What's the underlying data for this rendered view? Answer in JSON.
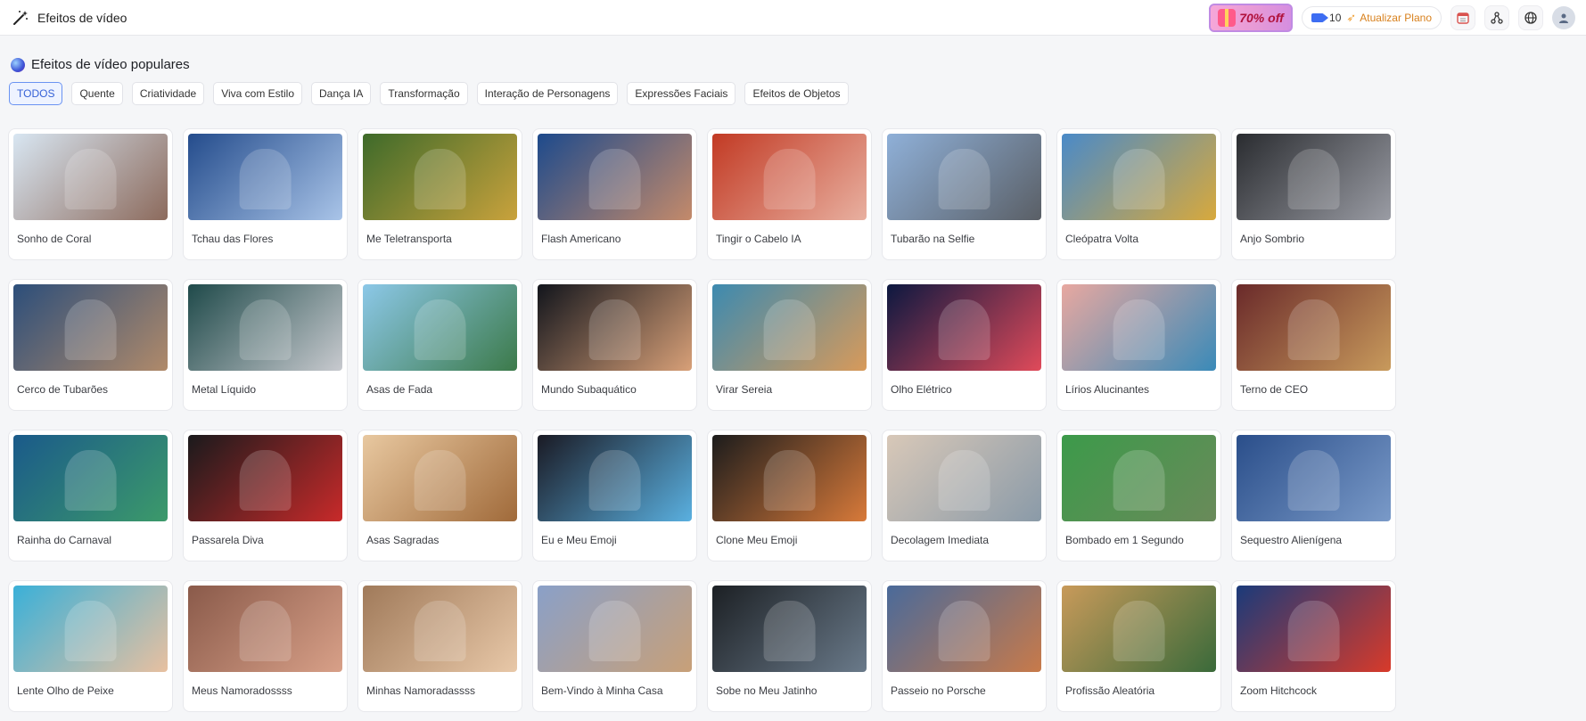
{
  "app": {
    "title": "Efeitos de vídeo",
    "title_icon": "magic-wand-icon"
  },
  "header": {
    "promo_label": "70% off",
    "credits": "10",
    "upgrade_label": "Atualizar Plano",
    "icons": [
      "calendar-icon",
      "share-network-icon",
      "globe-icon",
      "user-avatar-icon"
    ]
  },
  "section": {
    "title": "Efeitos de vídeo populares"
  },
  "filters": [
    {
      "label": "TODOS",
      "active": true
    },
    {
      "label": "Quente"
    },
    {
      "label": "Criatividade"
    },
    {
      "label": "Viva com Estilo"
    },
    {
      "label": "Dança IA"
    },
    {
      "label": "Transformação"
    },
    {
      "label": "Interação de Personagens"
    },
    {
      "label": "Expressões Faciais"
    },
    {
      "label": "Efeitos de Objetos"
    }
  ],
  "effects": [
    {
      "title": "Sonho de Coral",
      "colors": [
        "#d8e6f2",
        "#8c6a5c"
      ]
    },
    {
      "title": "Tchau das Flores",
      "colors": [
        "#244c8c",
        "#a9c4e8"
      ]
    },
    {
      "title": "Me Teletransporta",
      "colors": [
        "#3e6a2a",
        "#c9a23c"
      ]
    },
    {
      "title": "Flash Americano",
      "colors": [
        "#1d4a8c",
        "#c48a6a"
      ]
    },
    {
      "title": "Tingir o Cabelo IA",
      "colors": [
        "#c23a24",
        "#e8b0a0"
      ]
    },
    {
      "title": "Tubarão na Selfie",
      "colors": [
        "#8fb0d8",
        "#5a5f66"
      ]
    },
    {
      "title": "Cleópatra Volta",
      "colors": [
        "#4a8ac8",
        "#d8a93c"
      ]
    },
    {
      "title": "Anjo Sombrio",
      "colors": [
        "#2a2c30",
        "#9a9ca4"
      ]
    },
    {
      "title": "Cerco de Tubarões",
      "colors": [
        "#2c4e7a",
        "#b08a6a"
      ]
    },
    {
      "title": "Metal Líquido",
      "colors": [
        "#1f4a4a",
        "#c8cacf"
      ]
    },
    {
      "title": "Asas de Fada",
      "colors": [
        "#8cc8e8",
        "#3c7a4a"
      ]
    },
    {
      "title": "Mundo Subaquático",
      "colors": [
        "#12151c",
        "#d8a078"
      ]
    },
    {
      "title": "Virar Sereia",
      "colors": [
        "#3c8ab0",
        "#d89a5a"
      ]
    },
    {
      "title": "Olho Elétrico",
      "colors": [
        "#0c1840",
        "#e04a5a"
      ]
    },
    {
      "title": "Lírios Alucinantes",
      "colors": [
        "#e8a8a0",
        "#3a8ab8"
      ]
    },
    {
      "title": "Terno de CEO",
      "colors": [
        "#6a2a2a",
        "#c89a5c"
      ]
    },
    {
      "title": "Rainha do Carnaval",
      "colors": [
        "#1a5a8a",
        "#3c9a6a"
      ]
    },
    {
      "title": "Passarela Diva",
      "colors": [
        "#1a1a1c",
        "#c82a2a"
      ]
    },
    {
      "title": "Asas Sagradas",
      "colors": [
        "#e8c8a0",
        "#a06a3a"
      ]
    },
    {
      "title": "Eu e Meu Emoji",
      "colors": [
        "#1a1a24",
        "#5ab0e0"
      ]
    },
    {
      "title": "Clone Meu Emoji",
      "colors": [
        "#1c1c1c",
        "#d87a3a"
      ]
    },
    {
      "title": "Decolagem Imediata",
      "colors": [
        "#d8c8b8",
        "#8a9aa8"
      ]
    },
    {
      "title": "Bombado em 1 Segundo",
      "colors": [
        "#3c9a4a",
        "#6a8a5a"
      ]
    },
    {
      "title": "Sequestro Alienígena",
      "colors": [
        "#2a4e8a",
        "#7a9ac8"
      ]
    },
    {
      "title": "Lente Olho de Peixe",
      "colors": [
        "#3ab0d8",
        "#e8c0a0"
      ]
    },
    {
      "title": "Meus Namoradossss",
      "colors": [
        "#8a5a4a",
        "#d8a088"
      ]
    },
    {
      "title": "Minhas Namoradassss",
      "colors": [
        "#a07a5a",
        "#e8c8a8"
      ]
    },
    {
      "title": "Bem-Vindo à Minha Casa",
      "colors": [
        "#8aa0c8",
        "#c8a078"
      ]
    },
    {
      "title": "Sobe no Meu Jatinho",
      "colors": [
        "#1c2024",
        "#6a7a8a"
      ]
    },
    {
      "title": "Passeio no Porsche",
      "colors": [
        "#4a6a9a",
        "#c87a4a"
      ]
    },
    {
      "title": "Profissão Aleatória",
      "colors": [
        "#c89a5a",
        "#3a6a3a"
      ]
    },
    {
      "title": "Zoom Hitchcock",
      "colors": [
        "#1a3a7a",
        "#d83a2a"
      ]
    }
  ]
}
